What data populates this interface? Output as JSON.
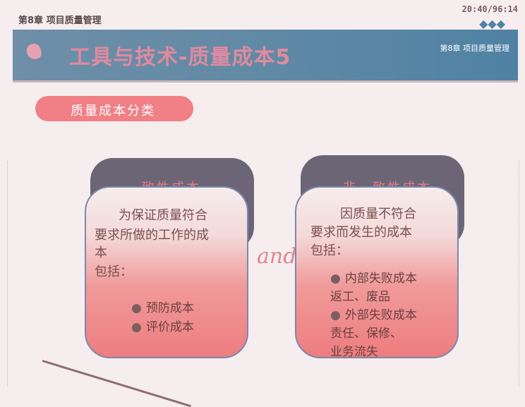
{
  "header": {
    "chapter": "第8章 项目质量管理",
    "clock": "20:40/96:14"
  },
  "title_band": {
    "title": "工具与技术-质量成本5",
    "chapter": "第8章 项目质量管理"
  },
  "category": "质量成本分类",
  "left_card": {
    "title": "一致性成本",
    "lines": [
      "为保证质量符合",
      "要求所做的工作的成",
      "本",
      "包括："
    ],
    "bullets": [
      "预防成本",
      "评价成本"
    ]
  },
  "connector": "and",
  "right_card": {
    "title": "非一致性成本",
    "lines": [
      "因质量不符合",
      "要求而发生的成本",
      "包括："
    ],
    "bullets": [
      {
        "label": "内部失败成本",
        "detail": "返工、废品"
      },
      {
        "label": "外部失败成本",
        "detail": "责任、保修、",
        "detail2": "业务流失"
      }
    ]
  }
}
